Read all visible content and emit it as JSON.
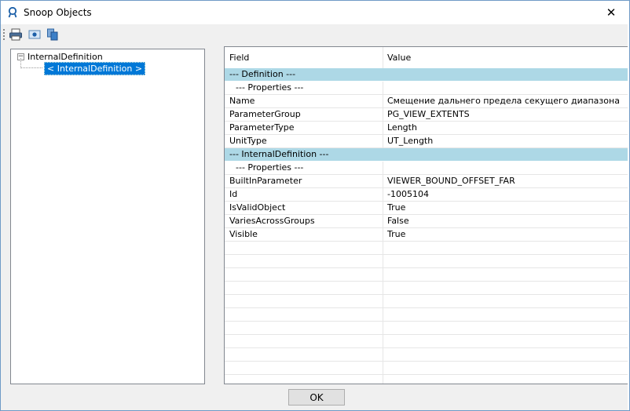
{
  "window": {
    "title": "Snoop Objects",
    "close_glyph": "✕"
  },
  "toolbar": {
    "buttons": [
      {
        "name": "print-icon",
        "tooltip": ""
      },
      {
        "name": "print-preview-icon",
        "tooltip": ""
      },
      {
        "name": "copy-icon",
        "tooltip": ""
      }
    ]
  },
  "tree": {
    "root_label": "InternalDefinition",
    "expander_glyph": "−",
    "child_label": "< InternalDefinition >"
  },
  "grid": {
    "columns": [
      "Field",
      "Value"
    ],
    "rows": [
      {
        "type": "section",
        "field": "--- Definition ---",
        "value": ""
      },
      {
        "type": "subheader",
        "field": "--- Properties ---",
        "value": ""
      },
      {
        "type": "data",
        "field": "Name",
        "value": "Смещение дальнего предела секущего диапазона"
      },
      {
        "type": "data",
        "field": "ParameterGroup",
        "value": "PG_VIEW_EXTENTS"
      },
      {
        "type": "data",
        "field": "ParameterType",
        "value": "Length"
      },
      {
        "type": "data",
        "field": "UnitType",
        "value": "UT_Length"
      },
      {
        "type": "section",
        "field": "--- InternalDefinition ---",
        "value": ""
      },
      {
        "type": "subheader",
        "field": "--- Properties ---",
        "value": ""
      },
      {
        "type": "data",
        "field": "BuiltInParameter",
        "value": "VIEWER_BOUND_OFFSET_FAR"
      },
      {
        "type": "data",
        "field": "Id",
        "value": "-1005104"
      },
      {
        "type": "data",
        "field": "IsValidObject",
        "value": "True"
      },
      {
        "type": "data",
        "field": "VariesAcrossGroups",
        "value": "False"
      },
      {
        "type": "data",
        "field": "Visible",
        "value": "True"
      }
    ],
    "section_color": "#add8e6"
  },
  "footer": {
    "ok_label": "OK"
  }
}
